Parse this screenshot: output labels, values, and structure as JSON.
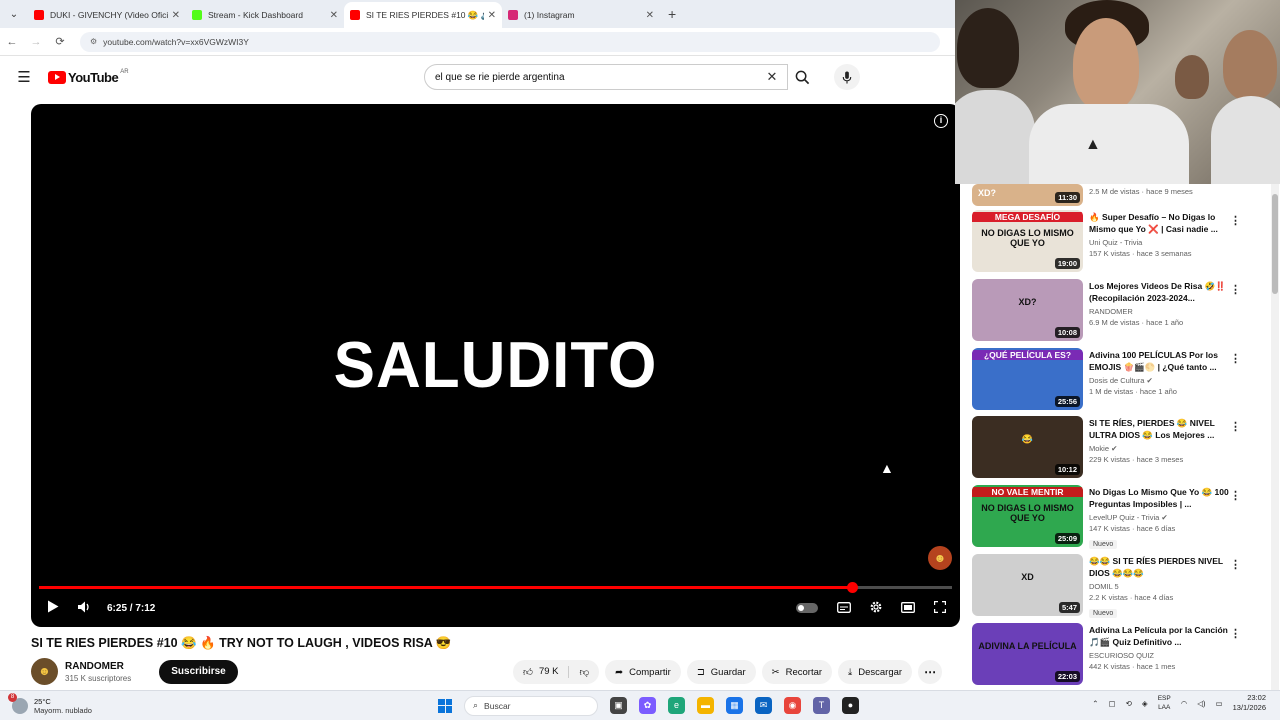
{
  "browser": {
    "tabs": [
      {
        "title": "DUKI - GIVENCHY (Video Oficia",
        "favicon_color": "#ff0000",
        "active": false
      },
      {
        "title": "Stream - Kick Dashboard",
        "favicon_color": "#53fc18",
        "active": false
      },
      {
        "title": "SI TE RIES PIERDES #10 😂 🔊",
        "favicon_color": "#ff0000",
        "active": true
      },
      {
        "title": "(1) Instagram",
        "favicon_color": "#d62976",
        "active": false
      }
    ],
    "url": "youtube.com/watch?v=xx6VGWzWI3Y"
  },
  "youtube": {
    "logo_text": "YouTube",
    "country_code": "AR",
    "search_value": "el que se rie pierde argentina"
  },
  "player": {
    "overlay_text": "SALUDITO",
    "time_display": "6:25 / 7:12",
    "progress_fraction": 0.891
  },
  "video": {
    "title": "SI TE RIES PIERDES #10 😂 🔥 TRY NOT TO LAUGH , VIDEOS RISA 😎",
    "channel_name": "RANDOMER",
    "subscribers": "315 K suscriptores",
    "subscribe_label": "Suscribirse",
    "likes": "79 K",
    "share_label": "Compartir",
    "save_label": "Guardar",
    "clip_label": "Recortar",
    "download_label": "Descargar"
  },
  "recommendations": [
    {
      "title": "",
      "channel": "",
      "meta": "2.5 M de vistas · hace 9 meses",
      "duration": "11:30",
      "thumb_text": "XD?",
      "thumb_bg": "#d9b28a",
      "partial": true,
      "new": false
    },
    {
      "title": "🔥 Super Desafío – No Digas lo Mismo que Yo ❌ | Casi nadie ...",
      "channel": "Uni Quiz - Trivia",
      "meta": "157 K vistas · hace 3 semanas",
      "duration": "19:00",
      "thumb_text": "NO DIGAS LO MISMO QUE YO",
      "thumb_badge": "MEGA DESAFÍO",
      "thumb_bg": "#e9e3d8",
      "badge_bg": "#d91e2a",
      "new": false
    },
    {
      "title": "Los Mejores Videos De Risa 🤣‼️ (Recopilación 2023-2024...",
      "channel": "RANDOMER",
      "meta": "6.9 M de vistas · hace 1 año",
      "duration": "10:08",
      "thumb_text": "XD?",
      "thumb_bg": "#b99ab8",
      "new": false
    },
    {
      "title": "Adivina 100 PELÍCULAS Por los EMOJIS 🍿🎬🌕 | ¿Qué tanto ...",
      "channel": "Dosis de Cultura ✔",
      "meta": "1 M de vistas · hace 1 año",
      "duration": "25:56",
      "thumb_text": "",
      "thumb_badge": "¿QUÉ PELÍCULA ES?",
      "thumb_bg": "#3a6fc9",
      "badge_bg": "#7a2bb5",
      "new": false
    },
    {
      "title": "SI TE RÍES, PIERDES 😂 NIVEL ULTRA DIOS 😂 Los Mejores ...",
      "channel": "Mokie ✔",
      "meta": "229 K vistas · hace 3 meses",
      "duration": "10:12",
      "thumb_text": "😂",
      "thumb_bg": "#3b2d22",
      "new": false
    },
    {
      "title": "No Digas Lo Mismo Que Yo 😂 100 Preguntas Imposibles | ...",
      "channel": "LevelUP Quiz - Trivia ✔",
      "meta": "147 K vistas · hace 6 días",
      "duration": "25:09",
      "thumb_text": "NO DIGAS LO MISMO QUE YO",
      "thumb_badge": "NO VALE MENTIR",
      "thumb_bg": "#2fa84f",
      "badge_bg": "#c21c1c",
      "new": true
    },
    {
      "title": "😂😂 SI TE RÍES PIERDES NIVEL DIOS 😂😂😂",
      "channel": "DOMIL 5",
      "meta": "2.2 K vistas · hace 4 días",
      "duration": "5:47",
      "thumb_text": "XD",
      "thumb_bg": "#cfcfcf",
      "new": true
    },
    {
      "title": "Adivina La Película por la Canción 🎵🎬 Quiz Definitivo ...",
      "channel": "ESCURIOSO QUIZ",
      "meta": "442 K vistas · hace 1 mes",
      "duration": "22:03",
      "thumb_text": "ADIVINA LA PELÍCULA",
      "thumb_bg": "#6b3fb8",
      "new": false
    }
  ],
  "taskbar": {
    "weather_temp": "25°C",
    "weather_desc": "Mayorm. nublado",
    "notification_count": "8",
    "search_placeholder": "Buscar",
    "lang_top": "ESP",
    "lang_bottom": "LAA",
    "time": "23:02",
    "date": "13/1/2026"
  }
}
